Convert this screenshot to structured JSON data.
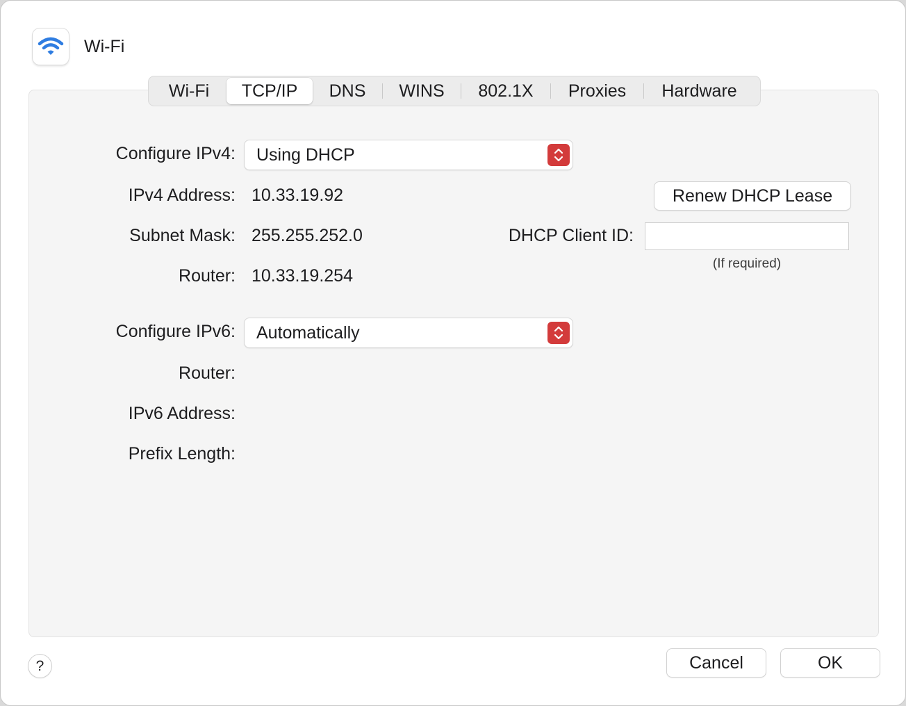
{
  "header": {
    "title": "Wi-Fi",
    "icon": "wifi-icon",
    "accent": "#2f7de1"
  },
  "tabs": [
    {
      "label": "Wi-Fi",
      "active": false
    },
    {
      "label": "TCP/IP",
      "active": true
    },
    {
      "label": "DNS",
      "active": false
    },
    {
      "label": "WINS",
      "active": false
    },
    {
      "label": "802.1X",
      "active": false
    },
    {
      "label": "Proxies",
      "active": false
    },
    {
      "label": "Hardware",
      "active": false
    }
  ],
  "ipv4": {
    "configure_label": "Configure IPv4:",
    "configure_value": "Using DHCP",
    "address_label": "IPv4 Address:",
    "address_value": "10.33.19.92",
    "subnet_label": "Subnet Mask:",
    "subnet_value": "255.255.252.0",
    "router_label": "Router:",
    "router_value": "10.33.19.254",
    "renew_button": "Renew DHCP Lease",
    "client_id_label": "DHCP Client ID:",
    "client_id_value": "",
    "client_id_hint": "(If required)"
  },
  "ipv6": {
    "configure_label": "Configure IPv6:",
    "configure_value": "Automatically",
    "router_label": "Router:",
    "address_label": "IPv6 Address:",
    "prefix_label": "Prefix Length:"
  },
  "footer": {
    "help_label": "?",
    "cancel_label": "Cancel",
    "ok_label": "OK"
  },
  "colors": {
    "popup_stepper": "#d33b3b"
  }
}
